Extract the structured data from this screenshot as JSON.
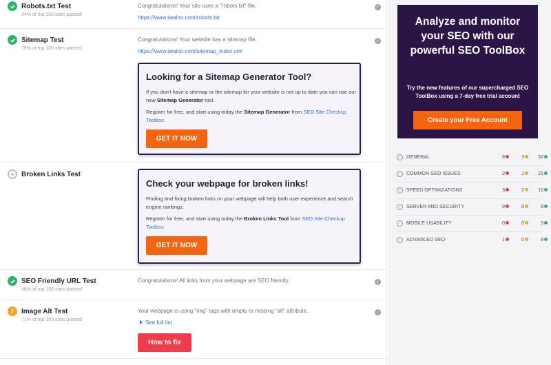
{
  "tests": {
    "robots": {
      "title": "Robots.txt Test",
      "sub": "94% of top 100 sites passed",
      "desc": "Congratulations! Your site uses a \"robots.txt\" file.",
      "link": "https://www.twaino.com/robots.txt",
      "status": "pass"
    },
    "sitemap": {
      "title": "Sitemap Test",
      "sub": "75% of top 100 sites passed",
      "desc": "Congratulations! Your website has a sitemap file.",
      "link": "https://www.twaino.com/sitemap_index.xml",
      "status": "pass"
    },
    "broken": {
      "title": "Broken Links Test",
      "status": "info"
    },
    "seo_url": {
      "title": "SEO Friendly URL Test",
      "sub": "40% of top 100 sites passed",
      "desc": "Congratulations! All links from your webpage are SEO friendly.",
      "status": "pass"
    },
    "image_alt": {
      "title": "Image Alt Test",
      "sub": "71% of top 100 sites passed",
      "desc": "Your webpage is using \"img\" tags with empty or missing \"alt\" attribute.",
      "see_full_list": "See full list",
      "how_to_fix": "How to fix",
      "status": "warning"
    }
  },
  "sitemap_promo": {
    "title": "Looking for a Sitemap Generator Tool?",
    "p1_pre": "If you don't have a sitemap or the sitemap for your website is not up to date you can use our new ",
    "p1_bold": "Sitemap Generator",
    "p1_post": " tool.",
    "p2_pre": "Register for free, and start using today the ",
    "p2_bold": "Sitemap Generator",
    "p2_mid": " from ",
    "p2_link": "SEO Site Checkup Toolbox",
    "p2_post": ".",
    "button": "GET IT NOW"
  },
  "broken_promo": {
    "title": "Check your webpage for broken links!",
    "p1": "Finding and fixing broken links on your webpage will help both user experience and search engine rankings.",
    "p2_pre": "Register for free, and start using today the ",
    "p2_bold": "Broken Links Tool",
    "p2_mid": " from ",
    "p2_link": "SEO Site Checkup Toolbox",
    "button": "GET IT NOW"
  },
  "ad": {
    "title": "Analyze and monitor your SEO with our powerful SEO ToolBox",
    "text": "Try the new features of our supercharged SEO ToolBox using a 7-day free trial account",
    "button": "Create your Free Account"
  },
  "categories": [
    {
      "label": "GENERAL",
      "failed": "8",
      "warnings": "3",
      "passed": "52"
    },
    {
      "label": "COMMON SEO ISSUES",
      "failed": "2",
      "warnings": "1",
      "passed": "21"
    },
    {
      "label": "SPEED OPTIMIZATIONS",
      "failed": "3",
      "warnings": "2",
      "passed": "12"
    },
    {
      "label": "SERVER AND SECURITY",
      "failed": "0",
      "warnings": "0",
      "passed": "8"
    },
    {
      "label": "MOBILE USABILITY",
      "failed": "0",
      "warnings": "0",
      "passed": "3"
    },
    {
      "label": "ADVANCED SEO",
      "failed": "1",
      "warnings": "0",
      "passed": "8"
    }
  ],
  "colors": {
    "accent_orange": "#f5640f",
    "fix_red": "#ef3b4a",
    "pass_green": "#2fb36b",
    "warn_orange": "#f5a524",
    "ad_purple": "#2b1546",
    "link_blue": "#2f6fdc"
  }
}
